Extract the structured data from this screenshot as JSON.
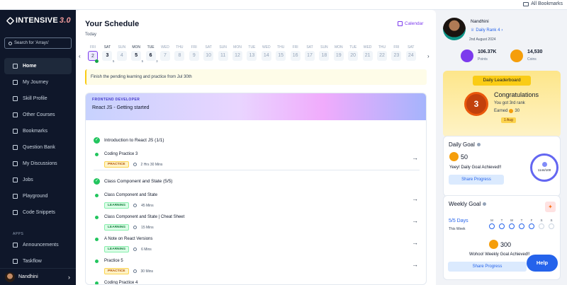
{
  "browser": {
    "bookmarks_label": "All Bookmarks"
  },
  "brand": {
    "name": "INTENSIVE",
    "version": "3.0"
  },
  "sidebar": {
    "search_placeholder": "Search for 'Arrays'",
    "items": [
      {
        "label": "Home",
        "icon": "home-icon"
      },
      {
        "label": "My Journey",
        "icon": "journey-icon"
      },
      {
        "label": "Skill Profile",
        "icon": "skill-icon"
      },
      {
        "label": "Other Courses",
        "icon": "courses-icon"
      },
      {
        "label": "Bookmarks",
        "icon": "bookmark-icon"
      },
      {
        "label": "Question Bank",
        "icon": "question-icon"
      },
      {
        "label": "My Discussions",
        "icon": "discussion-icon"
      },
      {
        "label": "Jobs",
        "icon": "jobs-icon"
      },
      {
        "label": "Playground",
        "icon": "terminal-icon"
      },
      {
        "label": "Code Snippets",
        "icon": "code-icon"
      }
    ],
    "apps_label": "APPS",
    "app_items": [
      {
        "label": "Announcements",
        "icon": "bell-icon"
      },
      {
        "label": "Taskflow",
        "icon": "check-icon"
      }
    ],
    "profile_name": "Nandhini"
  },
  "schedule": {
    "title": "Your Schedule",
    "today_label": "Today",
    "calendar_label": "Calendar",
    "days": [
      {
        "w": "FRI",
        "n": "2",
        "state": "sel"
      },
      {
        "w": "SAT",
        "n": "3",
        "state": "dark",
        "sub": "5"
      },
      {
        "w": "SUN",
        "n": "4",
        "state": ""
      },
      {
        "w": "MON",
        "n": "5",
        "state": "dark",
        "sub": "5"
      },
      {
        "w": "TUE",
        "n": "6",
        "state": "dark",
        "sub": "3"
      },
      {
        "w": "WED",
        "n": "7",
        "state": ""
      },
      {
        "w": "THU",
        "n": "8",
        "state": ""
      },
      {
        "w": "FRI",
        "n": "9",
        "state": ""
      },
      {
        "w": "SAT",
        "n": "10",
        "state": ""
      },
      {
        "w": "SUN",
        "n": "11",
        "state": ""
      },
      {
        "w": "MON",
        "n": "12",
        "state": ""
      },
      {
        "w": "TUE",
        "n": "13",
        "state": ""
      },
      {
        "w": "WED",
        "n": "14",
        "state": ""
      },
      {
        "w": "THU",
        "n": "15",
        "state": ""
      },
      {
        "w": "FRI",
        "n": "16",
        "state": ""
      },
      {
        "w": "SAT",
        "n": "17",
        "state": ""
      },
      {
        "w": "SUN",
        "n": "18",
        "state": ""
      },
      {
        "w": "MON",
        "n": "19",
        "state": ""
      },
      {
        "w": "TUE",
        "n": "20",
        "state": ""
      },
      {
        "w": "WED",
        "n": "21",
        "state": ""
      },
      {
        "w": "THU",
        "n": "22",
        "state": ""
      },
      {
        "w": "FRI",
        "n": "23",
        "state": ""
      },
      {
        "w": "SAT",
        "n": "24",
        "state": ""
      }
    ],
    "notice": "Finish the pending learning and practice from Jul 30th",
    "card_tag": "FRONTEND DEVELOPER",
    "card_title": "React JS - Getting started",
    "sections": [
      {
        "title": "Introduction to React JS (1/1)",
        "items": [
          {
            "title": "Coding Practice 3",
            "tag": "PRACTICE",
            "duration": "2 Hrs 30 Mins"
          }
        ]
      },
      {
        "title": "Class Component and State (5/5)",
        "items": [
          {
            "title": "Class Component and State",
            "tag": "LEARNING",
            "duration": "45 Mins"
          },
          {
            "title": "Class Component and State | Cheat Sheet",
            "tag": "LEARNING",
            "duration": "15 Mins"
          },
          {
            "title": "A Note on React Versions",
            "tag": "LEARNING",
            "duration": "6 Mins"
          },
          {
            "title": "Practice 5",
            "tag": "PRACTICE",
            "duration": "30 Mins"
          },
          {
            "title": "Coding Practice 4",
            "tag": "",
            "duration": ""
          }
        ]
      }
    ]
  },
  "user": {
    "name": "Nandhini",
    "rank": "Daily Rank 4",
    "date": "2nd August 2024",
    "points": "106.37K",
    "points_label": "Points",
    "coins": "14,530",
    "coins_label": "Coins"
  },
  "leaderboard": {
    "title": "Daily Leaderboard",
    "rank_number": "3",
    "congrats": "Congratulations",
    "got": "You got 3rd rank",
    "earned_label": "Earned",
    "earned_value": "30",
    "date_tag": "1 Aug"
  },
  "daily_goal": {
    "title": "Daily Goal",
    "coins": "50",
    "message": "Yeey! Daily Goal Achieved!!",
    "share": "Share Progress",
    "progress": "1144/100"
  },
  "weekly_goal": {
    "title": "Weekly Goal",
    "days_label": "5/5 Days",
    "week_label": "This Week",
    "week_days": [
      "M",
      "T",
      "W",
      "T",
      "F",
      "S",
      "S"
    ],
    "week_done": [
      true,
      true,
      true,
      true,
      true,
      false,
      false
    ],
    "coins": "300",
    "message": "Wohoo! Weekly Goal Achieved!!",
    "share": "Share Progress"
  },
  "help_label": "Help",
  "colors": {
    "accent": "#7c3aed",
    "sidebar": "#0f172a",
    "success": "#22c55e",
    "link": "#2563eb"
  }
}
